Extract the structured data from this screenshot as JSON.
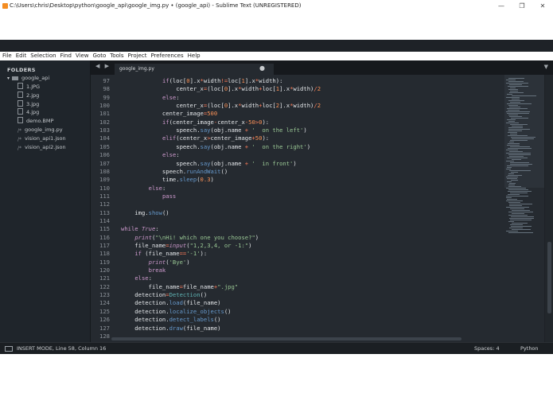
{
  "window": {
    "title": "C:\\Users\\chris\\Desktop\\python\\google_api\\google_img.py • (google_api) - Sublime Text (UNREGISTERED)",
    "controls": {
      "minimize": "—",
      "maximize": "❐",
      "close": "✕"
    }
  },
  "menu": [
    "File",
    "Edit",
    "Selection",
    "Find",
    "View",
    "Goto",
    "Tools",
    "Project",
    "Preferences",
    "Help"
  ],
  "sidebar": {
    "header": "FOLDERS",
    "root": "google_api",
    "files": [
      {
        "name": "1.JPG",
        "kind": "file"
      },
      {
        "name": "2.jpg",
        "kind": "file"
      },
      {
        "name": "3.jpg",
        "kind": "file"
      },
      {
        "name": "4.jpg",
        "kind": "file"
      },
      {
        "name": "demo.BMP",
        "kind": "file"
      },
      {
        "name": "google_img.py",
        "kind": "code"
      },
      {
        "name": "vision_api1.json",
        "kind": "code"
      },
      {
        "name": "vision_api2.json",
        "kind": "code"
      }
    ]
  },
  "tabs": {
    "nav": "◀ ▶",
    "active": "google_img.py",
    "dirty_marker": "●",
    "menu_icon": "▼"
  },
  "editor": {
    "lines": [
      {
        "n": "97",
        "t": "            if(loc[0].x*width!=loc[1].x*width):"
      },
      {
        "n": "98",
        "t": "                center_x=(loc[0].x*width+loc[1].x*width)/2"
      },
      {
        "n": "99",
        "t": "            else:"
      },
      {
        "n": "100",
        "t": "                center_x=(loc[0].x*width+loc[2].x*width)/2"
      },
      {
        "n": "101",
        "t": "            center_image=500"
      },
      {
        "n": "102",
        "t": "            if(center_image-center_x-50>0):"
      },
      {
        "n": "103",
        "t": "                speech.say(obj.name + '  on the left')"
      },
      {
        "n": "104",
        "t": "            elif(center_x>center_image+50):"
      },
      {
        "n": "105",
        "t": "                speech.say(obj.name + '  on the right')"
      },
      {
        "n": "106",
        "t": "            else:"
      },
      {
        "n": "107",
        "t": "                speech.say(obj.name + '  in front')"
      },
      {
        "n": "108",
        "t": "            speech.runAndWait()"
      },
      {
        "n": "109",
        "t": "            time.sleep(0.3)"
      },
      {
        "n": "110",
        "t": "        else:"
      },
      {
        "n": "111",
        "t": "            pass"
      },
      {
        "n": "112",
        "t": ""
      },
      {
        "n": "113",
        "t": "    img.show()"
      },
      {
        "n": "114",
        "t": ""
      },
      {
        "n": "115",
        "t": "while True:"
      },
      {
        "n": "116",
        "t": "    print(\"\\nHi! which one you choose?\")"
      },
      {
        "n": "117",
        "t": "    file_name=input(\"1,2,3,4, or -1:\")"
      },
      {
        "n": "118",
        "t": "    if (file_name=='-1'):"
      },
      {
        "n": "119",
        "t": "        print('Bye')"
      },
      {
        "n": "120",
        "t": "        break"
      },
      {
        "n": "121",
        "t": "    else:"
      },
      {
        "n": "122",
        "t": "        file_name=file_name+\".jpg\""
      },
      {
        "n": "123",
        "t": "    detection=Detection()"
      },
      {
        "n": "124",
        "t": "    detection.load(file_name)"
      },
      {
        "n": "125",
        "t": "    detection.localize_objects()"
      },
      {
        "n": "126",
        "t": "    detection.detect_labels()"
      },
      {
        "n": "127",
        "t": "    detection.draw(file_name)"
      },
      {
        "n": "128",
        "t": ""
      }
    ]
  },
  "status": {
    "message": "INSERT MODE, Line 58, Column 16",
    "spaces": "Spaces: 4",
    "syntax": "Python"
  },
  "colors": {
    "editor_bg": "#252a30",
    "sidebar_bg": "#1f252b",
    "keyword": "#cc99cc",
    "function": "#6699cc",
    "number": "#f99157",
    "string": "#99c794"
  }
}
